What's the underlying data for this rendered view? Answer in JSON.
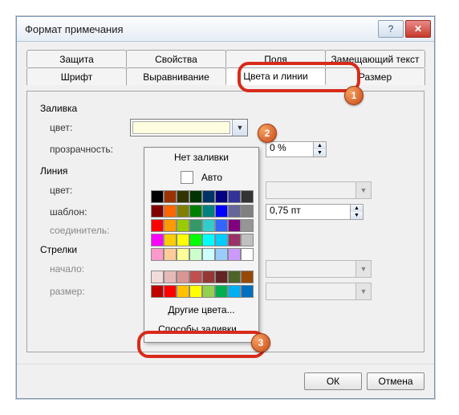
{
  "title": "Формат примечания",
  "tabs_row1": [
    "Защита",
    "Свойства",
    "Поля",
    "Замещающий текст"
  ],
  "tabs_row2": [
    "Шрифт",
    "Выравнивание",
    "Цвета и линии",
    "Размер"
  ],
  "active_tab": "Цвета и линии",
  "sections": {
    "fill": {
      "title": "Заливка",
      "color_label": "цвет:",
      "transparency_label": "прозрачность:",
      "transparency_value": "0 %"
    },
    "line": {
      "title": "Линия",
      "color_label": "цвет:",
      "pattern_label": "шаблон:",
      "connector_label": "соединитель:",
      "weight_value": "0,75 пт"
    },
    "arrows": {
      "title": "Стрелки",
      "begin_label": "начало:",
      "size_label": "размер:"
    }
  },
  "popup": {
    "no_fill": "Нет заливки",
    "auto": "Авто",
    "more_colors": "Другие цвета...",
    "fill_effects": "Способы заливки...",
    "theme_rows": [
      [
        "#000000",
        "#993300",
        "#333300",
        "#003300",
        "#003366",
        "#000080",
        "#333399",
        "#333333"
      ],
      [
        "#800000",
        "#ff6600",
        "#808000",
        "#008000",
        "#008080",
        "#0000ff",
        "#666699",
        "#808080"
      ],
      [
        "#ff0000",
        "#ff9900",
        "#99cc00",
        "#339966",
        "#33cccc",
        "#3366ff",
        "#800080",
        "#969696"
      ],
      [
        "#ff00ff",
        "#ffcc00",
        "#ffff00",
        "#00ff00",
        "#00ffff",
        "#00ccff",
        "#993366",
        "#c0c0c0"
      ],
      [
        "#ff99cc",
        "#ffcc99",
        "#ffff99",
        "#ccffcc",
        "#ccffff",
        "#99ccff",
        "#cc99ff",
        "#ffffff"
      ]
    ],
    "recent_rows": [
      [
        "#f2dcdb",
        "#e6b9b8",
        "#d99694",
        "#c0504d",
        "#953735",
        "#632523",
        "#4f6228",
        "#984807"
      ],
      [
        "#c00000",
        "#ff0000",
        "#ffc000",
        "#ffff00",
        "#92d050",
        "#00b050",
        "#00b0f0",
        "#0070c0"
      ]
    ]
  },
  "buttons": {
    "ok": "ОК",
    "cancel": "Отмена"
  },
  "badges": [
    "1",
    "2",
    "3"
  ]
}
